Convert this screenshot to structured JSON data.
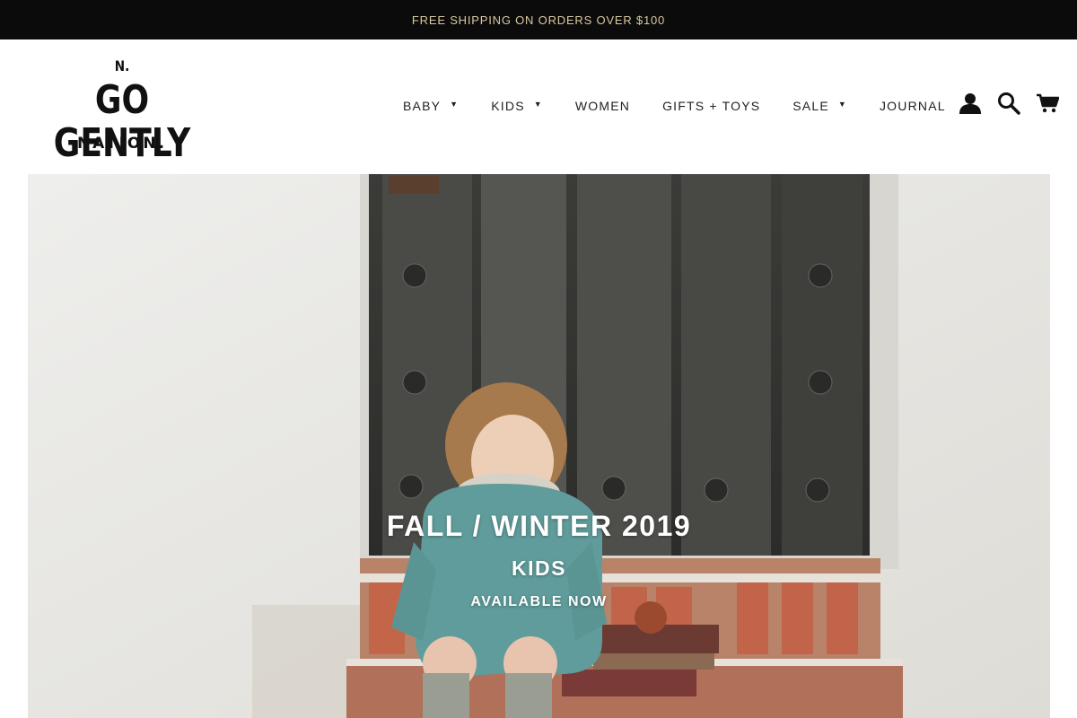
{
  "announcement": {
    "text": "FREE SHIPPING ON ORDERS OVER $100"
  },
  "logo": {
    "top": "N.",
    "main": "GO GENTLY",
    "bottom": "NATION."
  },
  "nav": {
    "items": [
      {
        "label": "BABY",
        "has_dropdown": true
      },
      {
        "label": "KIDS",
        "has_dropdown": true
      },
      {
        "label": "WOMEN",
        "has_dropdown": false
      },
      {
        "label": "GIFTS + TOYS",
        "has_dropdown": false
      },
      {
        "label": "SALE",
        "has_dropdown": true
      },
      {
        "label": "JOURNAL",
        "has_dropdown": false
      }
    ],
    "caret": "▼"
  },
  "header_icons": [
    "account-icon",
    "search-icon",
    "cart-icon"
  ],
  "hero": {
    "title": "FALL / WINTER 2019",
    "subtitle": "KIDS",
    "cta": "AVAILABLE NOW"
  },
  "colors": {
    "announcement_bg": "#0b0b0b",
    "announcement_text": "#d9c9a3",
    "text": "#111111"
  }
}
